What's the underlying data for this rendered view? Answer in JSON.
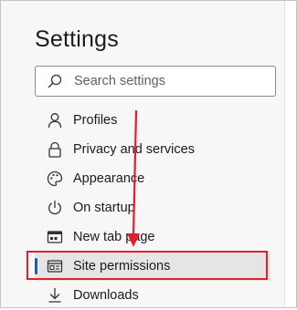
{
  "settings": {
    "title": "Settings",
    "search": {
      "placeholder": "Search settings",
      "icon": "search-icon"
    },
    "menu": [
      {
        "label": "Profiles",
        "icon": "person-icon"
      },
      {
        "label": "Privacy and services",
        "icon": "lock-icon"
      },
      {
        "label": "Appearance",
        "icon": "palette-icon"
      },
      {
        "label": "On startup",
        "icon": "power-icon"
      },
      {
        "label": "New tab page",
        "icon": "new-tab-icon"
      },
      {
        "label": "Site permissions",
        "icon": "site-permissions-icon",
        "active": true
      },
      {
        "label": "Downloads",
        "icon": "download-icon"
      }
    ]
  },
  "annotation": {
    "highlight_color": "#e0202b"
  },
  "colors": {
    "accent": "#1a5fb4"
  }
}
